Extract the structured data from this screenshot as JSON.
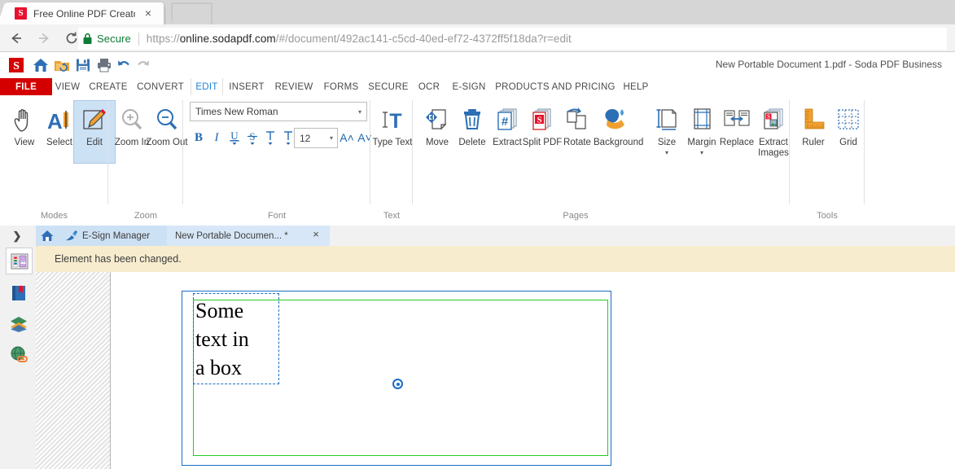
{
  "browser": {
    "tab": {
      "title": "Free Online PDF Creator",
      "favicon_letter": "S",
      "close_icon": "×"
    },
    "nav": {
      "back_icon": "back-arrow",
      "forward_icon": "forward-arrow",
      "reload_icon": "reload"
    },
    "omnibox": {
      "security_label": "Secure",
      "lock_icon": "lock-icon",
      "url_prefix": "https://",
      "url_domain": "online.sodapdf.com",
      "url_path": "/#/document/492ac141-c5cd-40ed-ef72-4372ff5f18da?r=edit",
      "url_full": "https://online.sodapdf.com/#/document/492ac141-c5cd-40ed-ef72-4372ff5f18da?r=edit"
    }
  },
  "app": {
    "document_title": "New Portable Document 1.pdf - Soda PDF Business",
    "quick_access": [
      {
        "name": "soda-logo",
        "label": "S"
      },
      {
        "name": "home-icon",
        "label": "Home"
      },
      {
        "name": "convert-icon",
        "label": "Convert"
      },
      {
        "name": "save-icon",
        "label": "Save"
      },
      {
        "name": "print-icon",
        "label": "Print"
      },
      {
        "name": "undo-icon",
        "label": "Undo"
      },
      {
        "name": "redo-icon",
        "label": "Redo"
      }
    ],
    "menu": {
      "file_label": "FILE",
      "items": [
        {
          "label": "VIEW",
          "active": false
        },
        {
          "label": "CREATE",
          "active": false
        },
        {
          "label": "CONVERT",
          "active": false
        },
        {
          "label": "EDIT",
          "active": true
        },
        {
          "label": "INSERT",
          "active": false
        },
        {
          "label": "REVIEW",
          "active": false
        },
        {
          "label": "FORMS",
          "active": false
        },
        {
          "label": "SECURE",
          "active": false
        },
        {
          "label": "OCR",
          "active": false
        },
        {
          "label": "E-SIGN",
          "active": false
        },
        {
          "label": "PRODUCTS AND PRICING",
          "active": false
        },
        {
          "label": "HELP",
          "active": false
        }
      ]
    },
    "ribbon": {
      "groups": [
        {
          "name": "modes",
          "label": "Modes",
          "buttons": [
            {
              "label": "View",
              "icon": "hand-icon",
              "selected": false
            },
            {
              "label": "Select",
              "icon": "select-text-icon",
              "selected": false
            },
            {
              "label": "Edit",
              "icon": "pencil-edit-icon",
              "selected": true
            }
          ]
        },
        {
          "name": "zoom",
          "label": "Zoom",
          "buttons": [
            {
              "label": "Zoom In",
              "icon": "magnifier-plus-icon",
              "selected": false
            },
            {
              "label": "Zoom Out",
              "icon": "magnifier-minus-icon",
              "selected": false
            }
          ]
        },
        {
          "name": "font",
          "label": "Font",
          "font_family_value": "Times New Roman",
          "font_size_value": "12",
          "dropdown_icon": "▾",
          "format_buttons": [
            {
              "label": "B",
              "name": "bold-button"
            },
            {
              "label": "I",
              "name": "italic-button"
            },
            {
              "label": "U",
              "name": "underline-button"
            },
            {
              "label": "S",
              "name": "strikethrough-button"
            },
            {
              "label": "T",
              "name": "subscript-button"
            },
            {
              "label": "T",
              "name": "superscript-button"
            },
            {
              "label": "A˄",
              "name": "increase-font-size-button"
            },
            {
              "label": "A˅",
              "name": "decrease-font-size-button"
            }
          ]
        },
        {
          "name": "text",
          "label": "Text",
          "buttons": [
            {
              "label": "Type Text",
              "icon": "type-text-icon",
              "selected": false
            }
          ]
        },
        {
          "name": "pages",
          "label": "Pages",
          "buttons": [
            {
              "label": "Move",
              "icon": "move-page-icon",
              "selected": false,
              "caret": false
            },
            {
              "label": "Delete",
              "icon": "trash-icon",
              "selected": false,
              "caret": false
            },
            {
              "label": "Extract",
              "icon": "extract-pages-icon",
              "selected": false,
              "caret": false
            },
            {
              "label": "Split PDF",
              "icon": "split-pdf-icon",
              "selected": false,
              "caret": false
            },
            {
              "label": "Rotate",
              "icon": "rotate-page-icon",
              "selected": false,
              "caret": false
            },
            {
              "label": "Background",
              "icon": "background-paint-icon",
              "selected": false,
              "caret": false
            },
            {
              "label": "Size",
              "icon": "page-size-icon",
              "selected": false,
              "caret": true
            },
            {
              "label": "Margin",
              "icon": "page-margin-icon",
              "selected": false,
              "caret": true
            },
            {
              "label": "Replace",
              "icon": "replace-page-icon",
              "selected": false,
              "caret": false
            },
            {
              "label": "Extract Images",
              "icon": "extract-images-icon",
              "selected": false,
              "caret": false
            }
          ]
        },
        {
          "name": "tools",
          "label": "Tools",
          "buttons": [
            {
              "label": "Ruler",
              "icon": "ruler-icon",
              "selected": false
            },
            {
              "label": "Grid",
              "icon": "grid-icon",
              "selected": false
            }
          ]
        }
      ]
    },
    "doc_tabs": {
      "expand_icon": "❯",
      "items": [
        {
          "label": "",
          "icon": "home-tab-icon",
          "active": false,
          "closable": false
        },
        {
          "label": "E-Sign Manager",
          "icon": "esign-pen-icon",
          "active": false,
          "closable": false
        },
        {
          "label": "New Portable Documen... *",
          "icon": "",
          "active": true,
          "closable": true,
          "close_icon": "×"
        }
      ]
    },
    "notification": {
      "message": "Element has been changed."
    },
    "rail": [
      {
        "name": "pages-panel-icon",
        "selected": true
      },
      {
        "name": "bookmarks-icon",
        "selected": false
      },
      {
        "name": "layers-icon",
        "selected": false
      },
      {
        "name": "links-icon",
        "selected": false
      }
    ],
    "document": {
      "text_lines": [
        "Some",
        "text in",
        "a box"
      ],
      "text_full": "Some text in a box",
      "selection_handle_icon": "resize-handle",
      "colors": {
        "page_border": "#1b6fc4",
        "object_border": "#22cc22",
        "selection_border": "#1b6fc4",
        "notification_bg": "#f7ecce",
        "accent_red": "#d40000",
        "accent_blue": "#1b7fd4"
      }
    }
  }
}
